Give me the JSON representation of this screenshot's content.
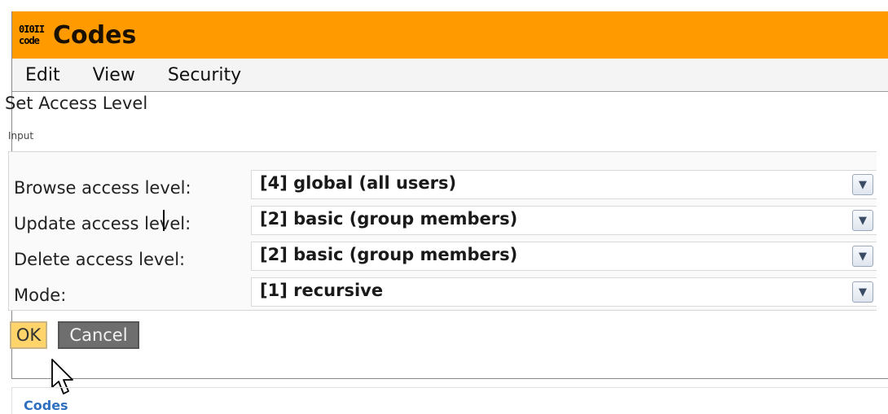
{
  "app": {
    "icon_lines": [
      "0I0II",
      "code"
    ],
    "title": "Codes"
  },
  "menu": [
    "Edit",
    "View",
    "Security"
  ],
  "dialog": {
    "title": "Set Access Level",
    "section_label": "Input",
    "fields": [
      {
        "label": "Browse access level:",
        "value": "[4] global (all users)"
      },
      {
        "label": "Update access level:",
        "value": "[2] basic (group members)"
      },
      {
        "label": "Delete access level:",
        "value": "[2] basic (group members)"
      },
      {
        "label": "Mode:",
        "value": "[1] recursive"
      }
    ],
    "ok_label": "OK",
    "cancel_label": "Cancel"
  },
  "footer": {
    "link": "Codes"
  },
  "colors": {
    "titlebar": "#ff9a00",
    "ok_button": "#ffd46a",
    "cancel_button": "#6e6e6e",
    "footer_link": "#2f6fc0"
  }
}
